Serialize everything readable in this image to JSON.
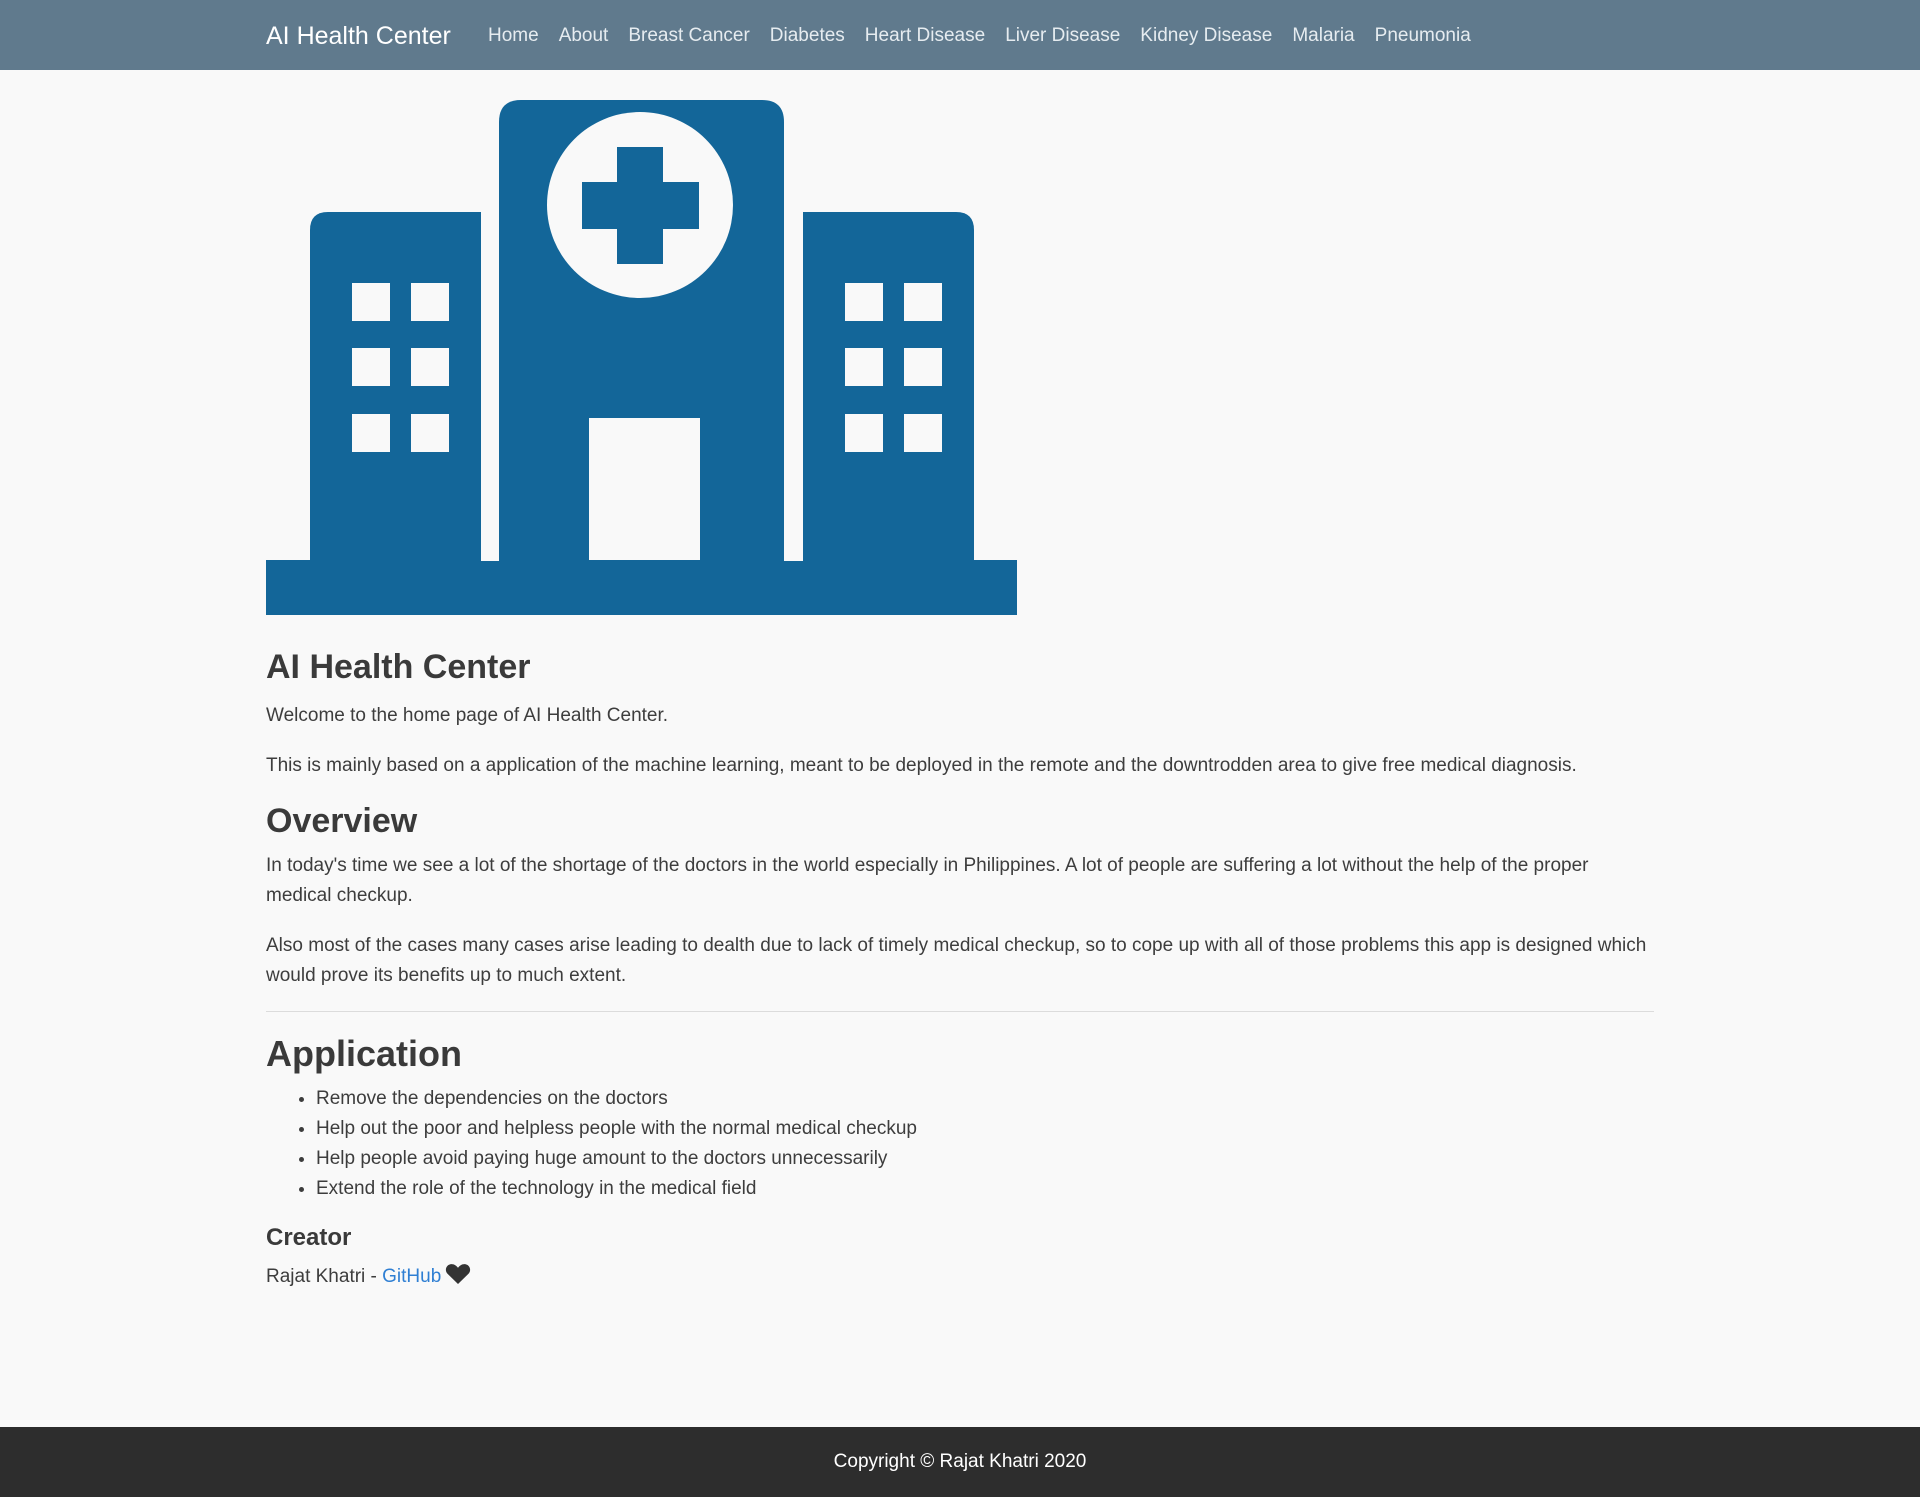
{
  "navbar": {
    "brand": "AI Health Center",
    "links": [
      "Home",
      "About",
      "Breast Cancer",
      "Diabetes",
      "Heart Disease",
      "Liver Disease",
      "Kidney Disease",
      "Malaria",
      "Pneumonia"
    ]
  },
  "hero": {
    "icon": "hospital-icon",
    "color": "#136699"
  },
  "main": {
    "title": "AI Health Center",
    "welcome": "Welcome to the home page of AI Health Center.",
    "intro": "This is mainly based on a application of the machine learning, meant to be deployed in the remote and the downtrodden area to give free medical diagnosis.",
    "overview_heading": "Overview",
    "overview_p1": "In today's time we see a lot of the shortage of the doctors in the world especially in Philippines. A lot of people are suffering a lot without the help of the proper medical checkup.",
    "overview_p2": "Also most of the cases many cases arise leading to dealth due to lack of timely medical checkup, so to cope up with all of those problems this app is designed which would prove its benefits up to much extent.",
    "application_heading": "Application",
    "application_items": [
      "Remove the dependencies on the doctors",
      "Help out the poor and helpless people with the normal medical checkup",
      "Help people avoid paying huge amount to the doctors unnecessarily",
      "Extend the role of the technology in the medical field"
    ],
    "creator_heading": "Creator",
    "creator_name": "Rajat Khatri - ",
    "creator_link": "GitHub",
    "creator_icon": "heart-icon"
  },
  "footer": {
    "text": "Copyright © Rajat Khatri 2020"
  }
}
